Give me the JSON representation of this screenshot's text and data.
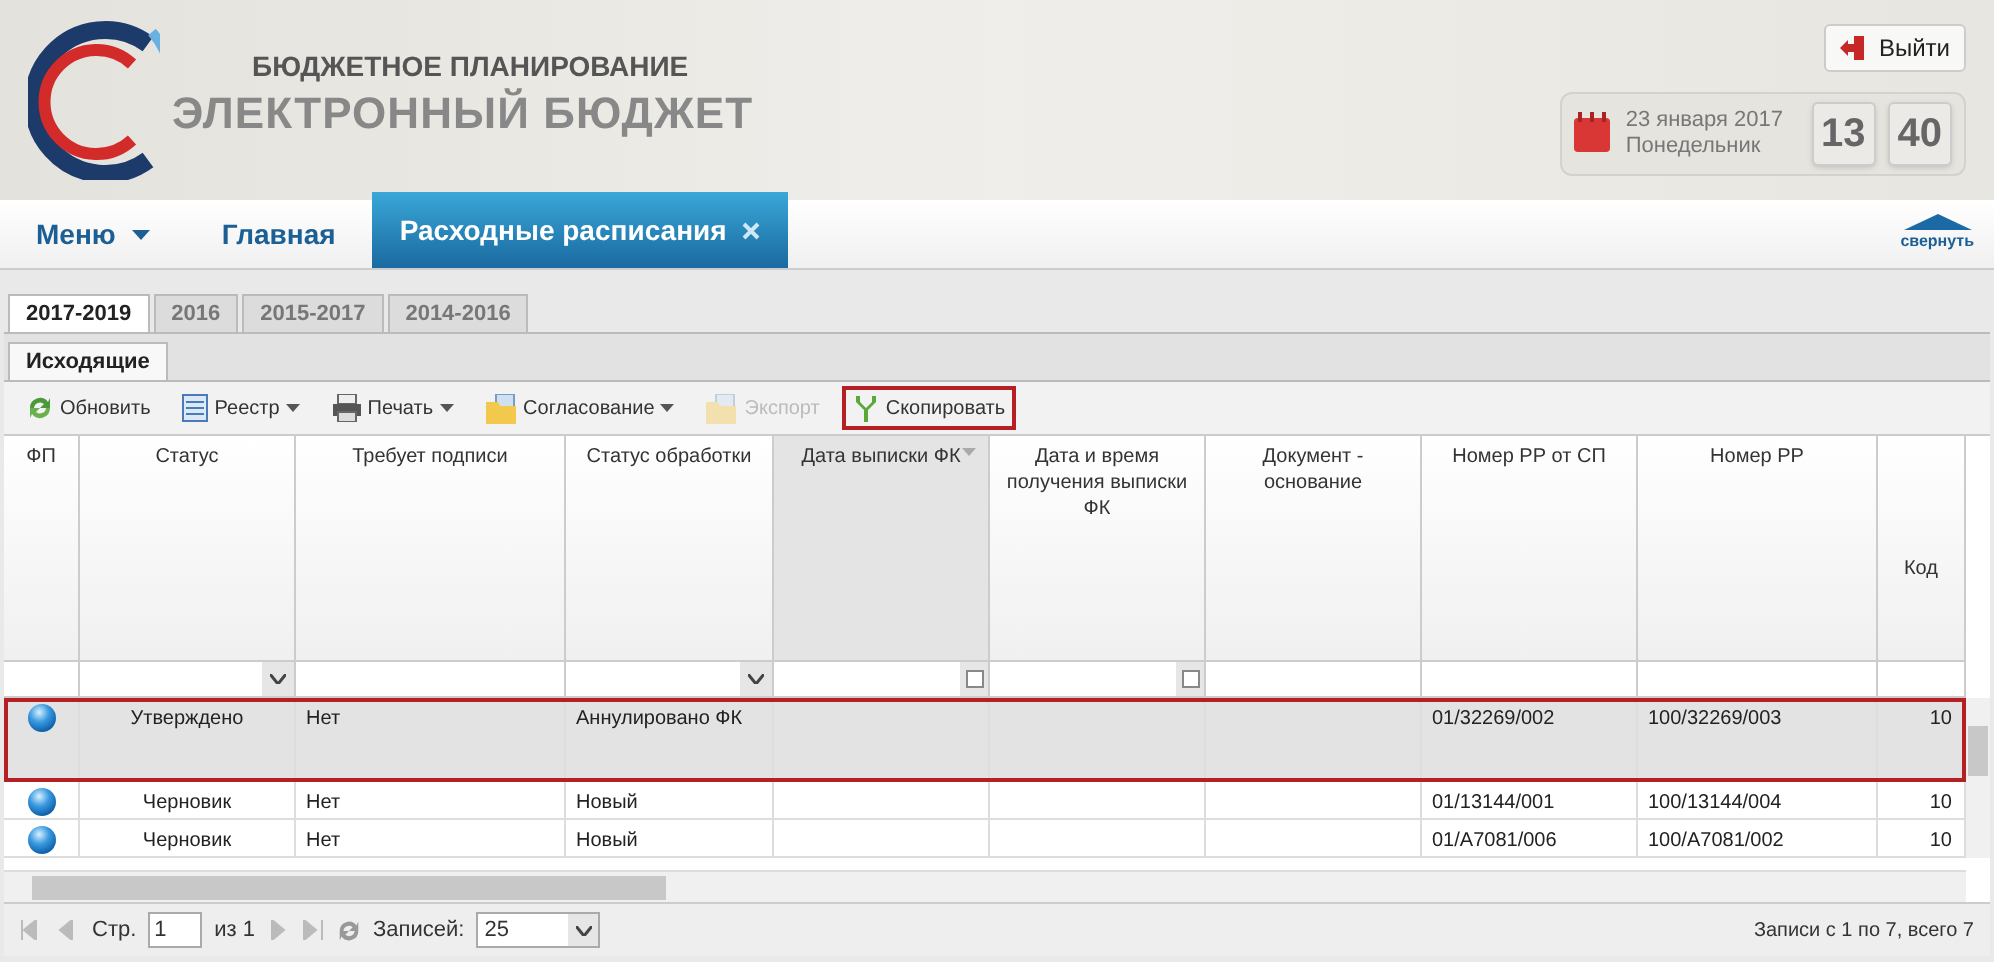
{
  "header": {
    "subtitle": "БЮДЖЕТНОЕ ПЛАНИРОВАНИЕ",
    "title": "ЭЛЕКТРОННЫЙ БЮДЖЕТ",
    "logout": "Выйти",
    "date": "23 января 2017",
    "weekday": "Понедельник",
    "hours": "13",
    "minutes": "40"
  },
  "nav": {
    "items": [
      {
        "label": "Меню",
        "kind": "menu",
        "selected": false
      },
      {
        "label": "Главная",
        "kind": "link",
        "selected": false
      },
      {
        "label": "Расходные расписания",
        "kind": "closable",
        "selected": true
      }
    ],
    "collapse": "свернуть"
  },
  "year_tabs": [
    {
      "label": "2017-2019",
      "selected": true
    },
    {
      "label": "2016",
      "selected": false
    },
    {
      "label": "2015-2017",
      "selected": false
    },
    {
      "label": "2014-2016",
      "selected": false
    }
  ],
  "sub_tabs": [
    {
      "label": "Исходящие",
      "selected": true
    }
  ],
  "toolbar": [
    {
      "label": "Обновить",
      "kind": "refresh",
      "has_menu": false,
      "disabled": false,
      "highlighted": false
    },
    {
      "label": "Реестр",
      "kind": "register",
      "has_menu": true,
      "disabled": false,
      "highlighted": false
    },
    {
      "label": "Печать",
      "kind": "print",
      "has_menu": true,
      "disabled": false,
      "highlighted": false
    },
    {
      "label": "Согласование",
      "kind": "folder",
      "has_menu": true,
      "disabled": false,
      "highlighted": false
    },
    {
      "label": "Экспорт",
      "kind": "folder",
      "has_menu": false,
      "disabled": true,
      "highlighted": false
    },
    {
      "label": "Скопировать",
      "kind": "copy",
      "has_menu": false,
      "disabled": false,
      "highlighted": true
    }
  ],
  "table": {
    "columns": [
      {
        "label": "ФП",
        "kind": "none",
        "sorted": false
      },
      {
        "label": "Статус",
        "kind": "select",
        "sorted": false
      },
      {
        "label": "Требует подписи",
        "kind": "text",
        "sorted": false
      },
      {
        "label": "Статус обработки",
        "kind": "select",
        "sorted": false
      },
      {
        "label": "Дата выписки ФК",
        "kind": "date",
        "sorted": true
      },
      {
        "label": "Дата и время получения выписки ФК",
        "kind": "date",
        "sorted": false
      },
      {
        "label": "Документ - основание",
        "kind": "text",
        "sorted": false
      },
      {
        "label": "Номер РР от СП",
        "kind": "text",
        "sorted": false
      },
      {
        "label": "Номер РР",
        "kind": "text",
        "sorted": false
      },
      {
        "label": "Код",
        "kind": "text",
        "sorted": false
      }
    ],
    "rows": [
      {
        "selected": true,
        "cells": [
          "",
          "Утверждено",
          "Нет",
          "Аннулировано ФК",
          "",
          "",
          "",
          "01/32269/002",
          "100/32269/003",
          "10"
        ]
      },
      {
        "selected": false,
        "cells": [
          "",
          "Черновик",
          "Нет",
          "Новый",
          "",
          "",
          "",
          "01/13144/001",
          "100/13144/004",
          "10"
        ]
      },
      {
        "selected": false,
        "cells": [
          "",
          "Черновик",
          "Нет",
          "Новый",
          "",
          "",
          "",
          "01/А7081/006",
          "100/А7081/002",
          "10"
        ]
      }
    ]
  },
  "paging": {
    "page_label": "Стр.",
    "page": "1",
    "of": "из 1",
    "size_label": "Записей:",
    "size": "25",
    "summary": "Записи с 1 по 7, всего 7"
  }
}
